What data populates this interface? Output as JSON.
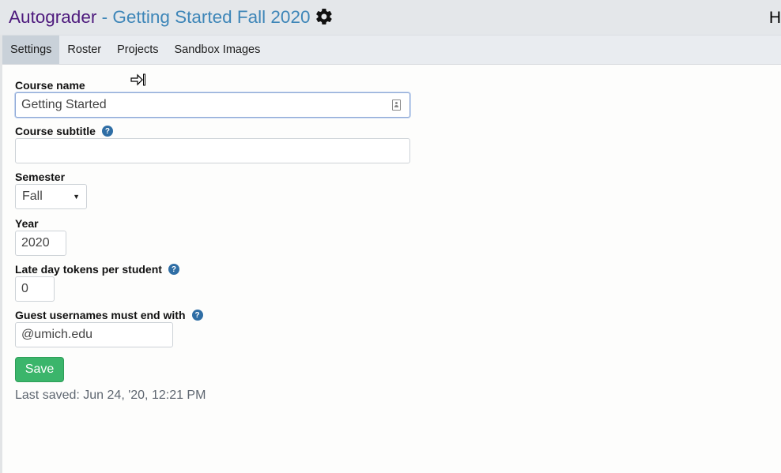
{
  "header": {
    "app_title": "Autograder",
    "course_title": " - Getting Started Fall 2020",
    "settings_icon": "gear-icon",
    "right_text": "H"
  },
  "tabs": [
    {
      "label": "Settings",
      "active": true
    },
    {
      "label": "Roster",
      "active": false
    },
    {
      "label": "Projects",
      "active": false
    },
    {
      "label": "Sandbox Images",
      "active": false
    }
  ],
  "form": {
    "course_name": {
      "label": "Course name",
      "value": "Getting Started"
    },
    "course_subtitle": {
      "label": "Course subtitle",
      "value": "",
      "help_icon": "question-circle-icon"
    },
    "semester": {
      "label": "Semester",
      "value": "Fall"
    },
    "year": {
      "label": "Year",
      "value": "2020"
    },
    "late_day_tokens": {
      "label": "Late day tokens per student",
      "value": "0",
      "help_icon": "question-circle-icon"
    },
    "guest_usernames": {
      "label": "Guest usernames must end with",
      "value": "@umich.edu",
      "help_icon": "question-circle-icon"
    },
    "save_label": "Save",
    "last_saved": "Last saved: Jun 24, '20, 12:21 PM"
  },
  "colors": {
    "app_title": "#4e1a7d",
    "course_title": "#3e86b8",
    "save_button": "#3bb56b",
    "help_icon": "#2f6ea5"
  }
}
